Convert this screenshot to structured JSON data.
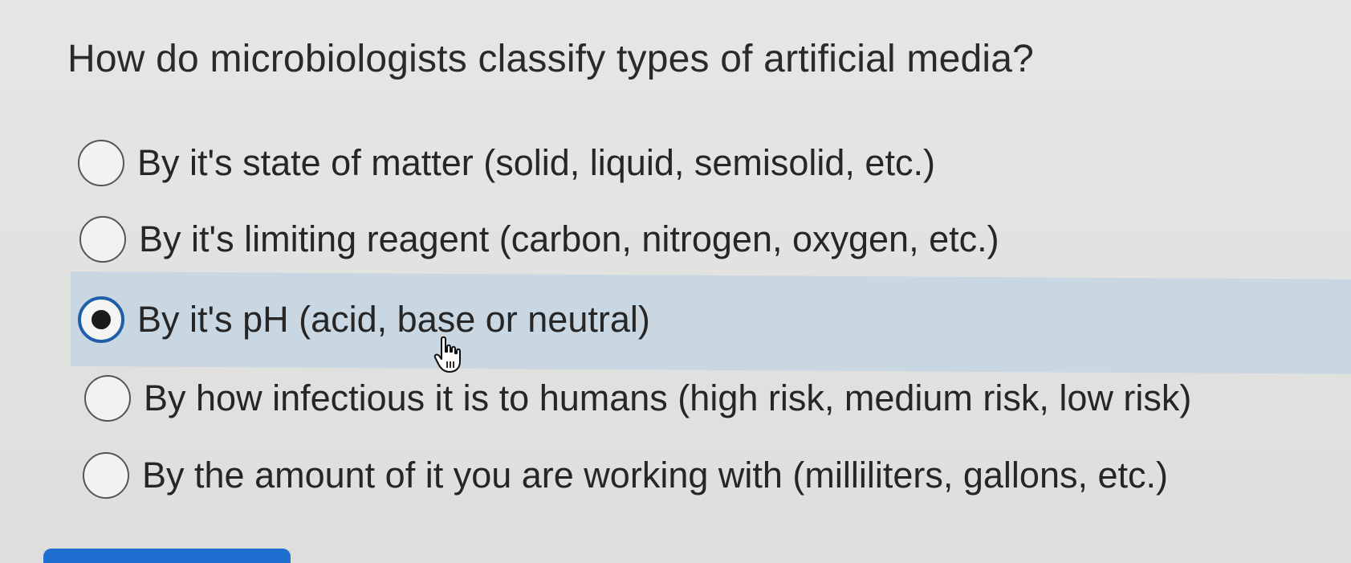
{
  "question": {
    "text": "How do microbiologists classify types of artificial media?"
  },
  "options": [
    {
      "label": "By it's state of matter (solid, liquid, semisolid, etc.)",
      "selected": false
    },
    {
      "label": "By it's limiting reagent (carbon, nitrogen, oxygen, etc.)",
      "selected": false
    },
    {
      "label": "By it's pH (acid, base or neutral)",
      "selected": true
    },
    {
      "label": "By how infectious it is to humans (high risk, medium risk, low risk)",
      "selected": false
    },
    {
      "label": "By the amount of it you are working with (milliliters, gallons, etc.)",
      "selected": false
    }
  ],
  "colors": {
    "background": "#e3e3e1",
    "selected_highlight": "#c9d7e3",
    "radio_selected_ring": "#1f5ea8",
    "button": "#1f6fd0"
  },
  "icons": {
    "cursor": "hand-pointer-icon"
  }
}
